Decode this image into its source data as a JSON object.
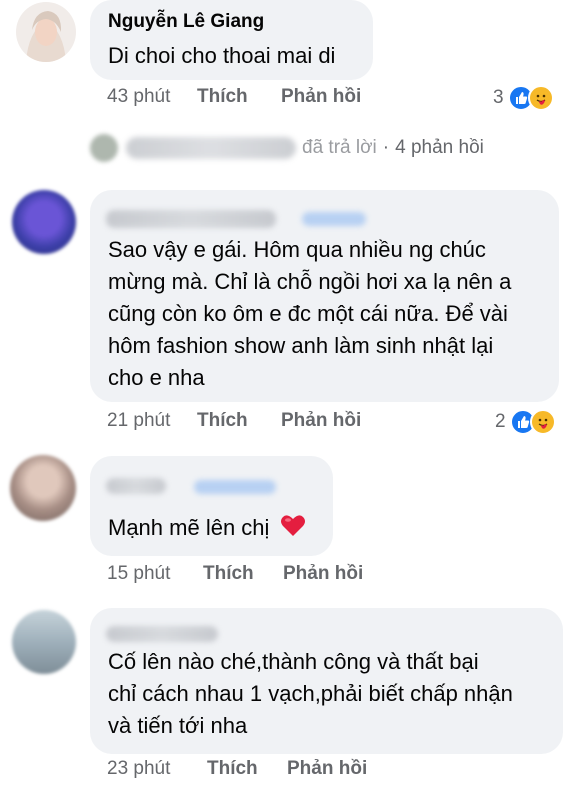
{
  "comments": [
    {
      "author": "Nguyễn Lê Giang",
      "text": "Di choi cho thoai mai di",
      "time": "43 phút",
      "like_label": "Thích",
      "reply_label": "Phản hồi",
      "reaction_count": "3",
      "reactions": [
        "like-icon",
        "care-icon"
      ]
    },
    {
      "author": "",
      "text_lines": [
        "Sao vậy e gái. Hôm qua nhiều ng chúc",
        "mừng mà. Chỉ là chỗ ngồi hơi xa lạ nên a",
        "cũng còn ko ôm e đc một cái nữa. Để vài",
        "hôm fashion show anh làm sinh nhật lại",
        "cho e nha"
      ],
      "time": "21 phút",
      "like_label": "Thích",
      "reply_label": "Phản hồi",
      "reaction_count": "2",
      "reactions": [
        "like-icon",
        "care-icon"
      ]
    },
    {
      "author": "",
      "text": "Mạnh mẽ lên chị",
      "emoji": "❤️",
      "time": "15 phút",
      "like_label": "Thích",
      "reply_label": "Phản hồi"
    },
    {
      "author": "",
      "text_lines": [
        "Cố lên nào ché,thành công và thất bại",
        "chỉ cách nhau 1 vạch,phải biết chấp nhận",
        "và tiến tới nha"
      ],
      "time": "23 phút",
      "like_label": "Thích",
      "reply_label": "Phản hồi"
    }
  ],
  "replies_summary": {
    "partial_text": "đã trả lời",
    "separator": "·",
    "count_text": "4 phản hồi"
  },
  "colors": {
    "bubble": "#f0f2f5",
    "meta": "#65676b",
    "like_blue": "#1877f2",
    "care_yellow": "#f7b928",
    "heart_red": "#e41e3f"
  }
}
